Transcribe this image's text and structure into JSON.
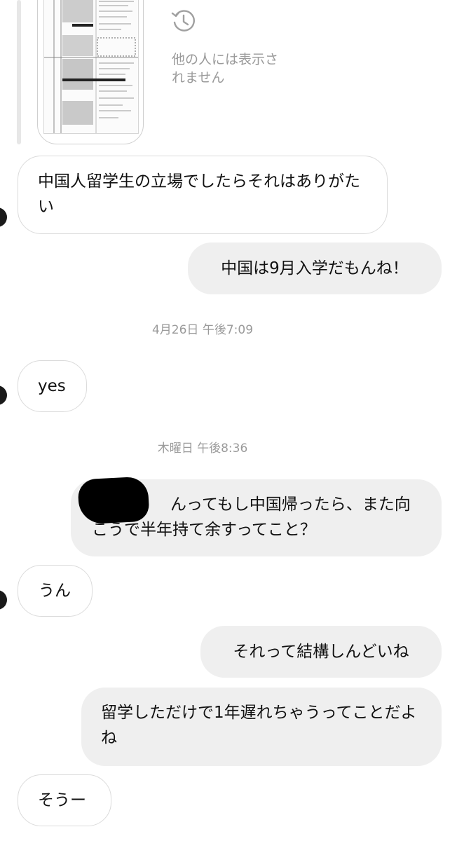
{
  "shared_image": {
    "hidden_note": "他の人には表示されません",
    "icon": "history-icon"
  },
  "messages": [
    {
      "direction": "received",
      "text": "中国人留学生の立場でしたらそれはありがたい"
    },
    {
      "direction": "sent",
      "text": "中国は9月入学だもんね！"
    },
    {
      "timestamp": "4月26日 午後7:09"
    },
    {
      "direction": "received",
      "text": "yes"
    },
    {
      "timestamp": "木曜日 午後8:36"
    },
    {
      "direction": "sent",
      "text": "んってもし中国帰ったら、また向こうで半年持て余すってこと？",
      "redacted_prefix": true
    },
    {
      "direction": "received",
      "text": "うん"
    },
    {
      "direction": "sent",
      "text": "それって結構しんどいね"
    },
    {
      "direction": "sent",
      "text": "留学しただけで1年遅れちゃうってことだよね"
    },
    {
      "direction": "received",
      "text": "そうー"
    }
  ],
  "colors": {
    "sent_bubble": "#efefef",
    "received_border": "#dbdbdb",
    "timestamp_text": "#9a9a9a"
  }
}
